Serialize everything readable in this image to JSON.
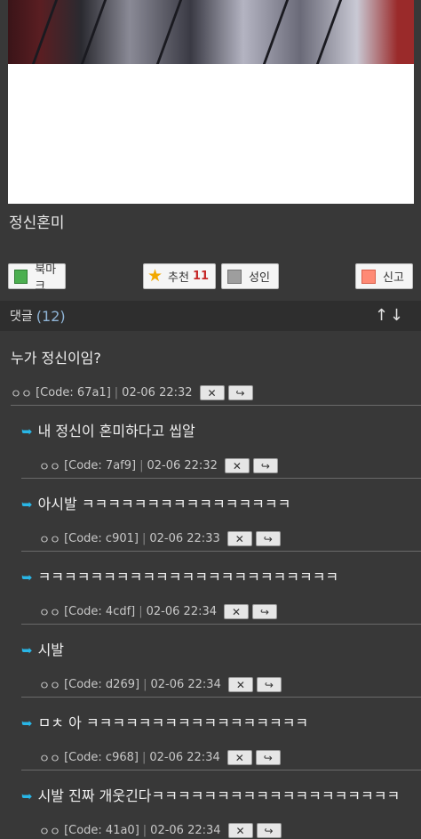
{
  "comic_title": "정신혼미",
  "actions": {
    "bookmark": "북마크",
    "recommend": "추천",
    "recommend_count": "11",
    "adult": "성인",
    "report": "신고"
  },
  "comments_header": {
    "label": "댓글",
    "count": "(12)",
    "sort": "↑↓"
  },
  "comments": [
    {
      "text": "누가 정신이임?",
      "author": "ㅇㅇ",
      "code": "[Code: 67a1]",
      "date": "02-06 22:32"
    },
    {
      "text": "내 정신이 혼미하다고 씹알",
      "author": "ㅇㅇ",
      "code": "[Code: 7af9]",
      "date": "02-06 22:32"
    },
    {
      "text": "아시발 ㅋㅋㅋㅋㅋㅋㅋㅋㅋㅋㅋㅋㅋㅋㅋㅋ",
      "author": "ㅇㅇ",
      "code": "[Code: c901]",
      "date": "02-06 22:33"
    },
    {
      "text": "ㅋㅋㅋㅋㅋㅋㅋㅋㅋㅋㅋㅋㅋㅋㅋㅋㅋㅋㅋㅋㅋㅋㅋ",
      "author": "ㅇㅇ",
      "code": "[Code: 4cdf]",
      "date": "02-06 22:34"
    },
    {
      "text": "시발",
      "author": "ㅇㅇ",
      "code": "[Code: d269]",
      "date": "02-06 22:34"
    },
    {
      "text": "ㅁㅊ 아 ㅋㅋㅋㅋㅋㅋㅋㅋㅋㅋㅋㅋㅋㅋㅋㅋㅋ",
      "author": "ㅇㅇ",
      "code": "[Code: c968]",
      "date": "02-06 22:34"
    },
    {
      "text": "시발 진짜 개웃긴다ㅋㅋㅋㅋㅋㅋㅋㅋㅋㅋㅋㅋㅋㅋㅋㅋㅋㅋㅋ",
      "author": "ㅇㅇ",
      "code": "[Code: 41a0]",
      "date": "02-06 22:34"
    }
  ],
  "icons": {
    "delete": "close-icon",
    "reply": "reply-arrow-icon"
  },
  "colors": {
    "bookmark": "#4caf50",
    "report": "#ff8a75",
    "accent_count": "#c62828",
    "reply_arrow": "#29b6e6"
  }
}
